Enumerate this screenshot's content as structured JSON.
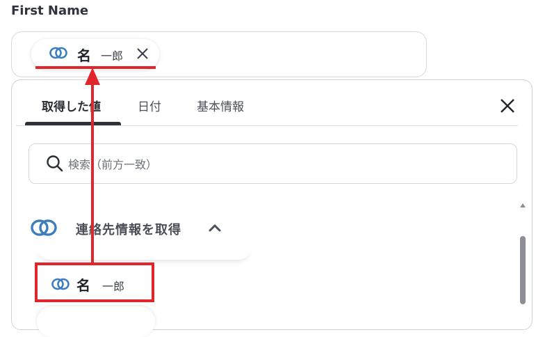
{
  "field": {
    "label": "First Name"
  },
  "chip": {
    "key": "名",
    "value": "一郎",
    "icon": "link-icon",
    "close_icon": "close-icon"
  },
  "panel": {
    "tabs": [
      {
        "label": "取得した値",
        "active": true
      },
      {
        "label": "日付",
        "active": false
      },
      {
        "label": "基本情報",
        "active": false
      }
    ],
    "close_icon": "close-icon",
    "search": {
      "placeholder": "検索（前方一致）",
      "value": "",
      "icon": "search-icon"
    },
    "section": {
      "title": "連絡先情報を取得",
      "icon": "link-icon",
      "expanded": true
    },
    "items": [
      {
        "key": "名",
        "value": "一郎",
        "icon": "link-icon"
      }
    ]
  },
  "annotation": {
    "color": "#e0262b"
  },
  "colors": {
    "link_icon": "#3d7dbf",
    "text": "#333840"
  }
}
